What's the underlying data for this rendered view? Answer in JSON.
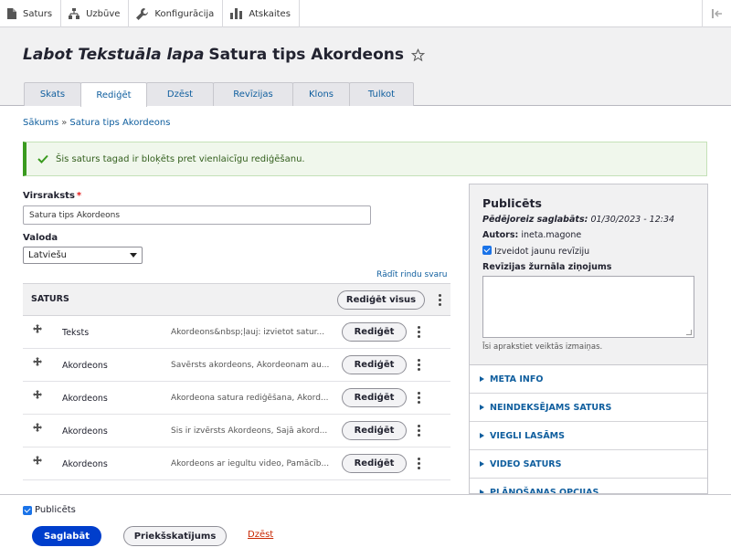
{
  "toolbar": {
    "items": [
      {
        "label": "Saturs",
        "icon": "file-icon"
      },
      {
        "label": "Uzbūve",
        "icon": "structure-icon"
      },
      {
        "label": "Konfigurācija",
        "icon": "wrench-icon"
      },
      {
        "label": "Atskaites",
        "icon": "bar-chart-icon"
      }
    ],
    "collapse_icon": "collapse-tray-icon"
  },
  "header": {
    "title_italic": "Labot Tekstuāla lapa",
    "title_rest": "Satura tips Akordeons",
    "tabs": [
      "Skats",
      "Rediģēt",
      "Dzēst",
      "Revīzijas",
      "Klons",
      "Tulkot"
    ],
    "active_tab": "Rediģēt"
  },
  "breadcrumb": {
    "home": "Sākums",
    "separator": "»",
    "current": "Satura tips Akordeons"
  },
  "message": {
    "text": "Šis saturs tagad ir bloķēts pret vienlaicīgu rediģēšanu.",
    "status_color": "#3a9b1f"
  },
  "form": {
    "title_label": "Virsraksts",
    "required_mark": "*",
    "title_value": "Satura tips Akordeons",
    "language_label": "Valoda",
    "language_value": "Latviešu",
    "row_weights_link": "Rādīt rindu svaru"
  },
  "paragraphs": {
    "header": "SATURS",
    "edit_all": "Rediģēt visus",
    "rows": [
      {
        "type": "Teksts",
        "summary": "Akordeons&nbsp;ļauj: izvietot satur...",
        "button": "Rediģēt"
      },
      {
        "type": "Akordeons",
        "summary": "Savērsts akordeons, Akordeonam au...",
        "button": "Rediģēt"
      },
      {
        "type": "Akordeons",
        "summary": "Akordeona satura rediģēšana, Akord...",
        "button": "Rediģēt"
      },
      {
        "type": "Akordeons",
        "summary": "Šis ir izvērsts Akordeons, Šajā akord...",
        "button": "Rediģēt"
      },
      {
        "type": "Akordeons",
        "summary": "Akordeons ar iegultu video, Pamācīb...",
        "button": "Rediģēt"
      }
    ]
  },
  "sidebar": {
    "status": "Publicēts",
    "last_saved_label": "Pēdējoreiz saglabāts:",
    "last_saved_value": "01/30/2023 - 12:34",
    "author_label": "Autors:",
    "author_value": "ineta.magone",
    "new_revision_label": "Izveidot jaunu revīziju",
    "log_label": "Revīzijas žurnāla ziņojums",
    "log_hint": "Īsi aprakstiet veiktās izmaiņas.",
    "sections": [
      "META INFO",
      "NEINDEKSĒJAMS SATURS",
      "VIEGLI LASĀMS",
      "VIDEO SATURS",
      "PLĀNOŠANAS OPCIJAS"
    ]
  },
  "footer": {
    "published_label": "Publicēts",
    "save": "Saglabāt",
    "preview": "Priekšskatījums",
    "delete": "Dzēst"
  },
  "colors": {
    "primary": "#003ecc",
    "link": "#0f5e9e",
    "danger": "#c82600"
  }
}
